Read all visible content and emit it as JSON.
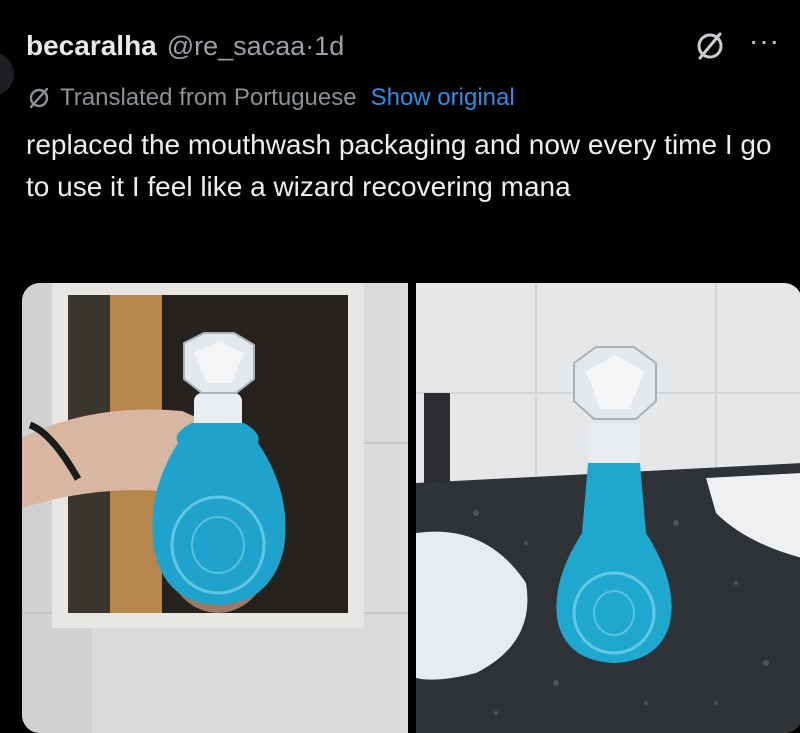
{
  "tweet": {
    "display_name": "becaralha",
    "handle": "@re_sacaa",
    "separator": "·",
    "time": "1d",
    "translation_label": "Translated from Portuguese",
    "show_original_label": "Show original",
    "text": "replaced the mouthwash packaging and now every time I go to use it I feel like a wizard recovering mana"
  },
  "icons": {
    "grok": "grok-icon",
    "more": "more-icon",
    "translate": "translate-icon"
  },
  "colors": {
    "background": "#000000",
    "text": "#e7e9ea",
    "secondary_text": "#8b9196",
    "link": "#2f8fe6",
    "mouthwash": "#1ea8d0"
  },
  "media": {
    "images": [
      {
        "description_name": "photo-bottle-in-hand"
      },
      {
        "description_name": "photo-bottle-on-sink"
      }
    ]
  }
}
